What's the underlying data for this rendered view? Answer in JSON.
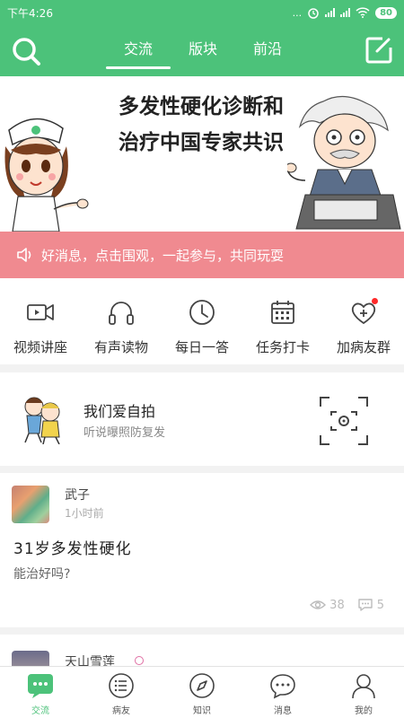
{
  "status_bar": {
    "time": "下午4:26",
    "dots": "...",
    "battery": "80"
  },
  "nav": {
    "tabs": [
      {
        "label": "交流",
        "active": true
      },
      {
        "label": "版块"
      },
      {
        "label": "前沿"
      }
    ]
  },
  "banner": {
    "title_line1": "多发性硬化诊断和",
    "title_line2": "治疗中国专家共识"
  },
  "notice": {
    "text": "好消息，点击围观，一起参与，共同玩耍"
  },
  "quick_menu": [
    {
      "label": "视频讲座",
      "icon": "video-icon"
    },
    {
      "label": "有声读物",
      "icon": "headphones-icon"
    },
    {
      "label": "每日一答",
      "icon": "clock-icon"
    },
    {
      "label": "任务打卡",
      "icon": "calendar-icon"
    },
    {
      "label": "加病友群",
      "icon": "heart-plus-icon",
      "has_dot": true
    }
  ],
  "selfie_card": {
    "title": "我们爱自拍",
    "subtitle": "听说曝照防复发"
  },
  "posts": [
    {
      "author": "武子",
      "time": "1小时前",
      "title": "31岁多发性硬化",
      "body": "能治好吗?",
      "views": "38",
      "comments": "5"
    },
    {
      "author": "天山雪莲"
    }
  ],
  "bottom_nav": [
    {
      "label": "交流",
      "icon": "chat-icon",
      "active": true
    },
    {
      "label": "病友",
      "icon": "list-icon"
    },
    {
      "label": "知识",
      "icon": "compass-icon"
    },
    {
      "label": "消息",
      "icon": "message-icon"
    },
    {
      "label": "我的",
      "icon": "person-icon"
    }
  ],
  "colors": {
    "brand_green": "#4cc27a",
    "notice_pink": "#f08a90",
    "badge_red": "#ff2a2a"
  }
}
